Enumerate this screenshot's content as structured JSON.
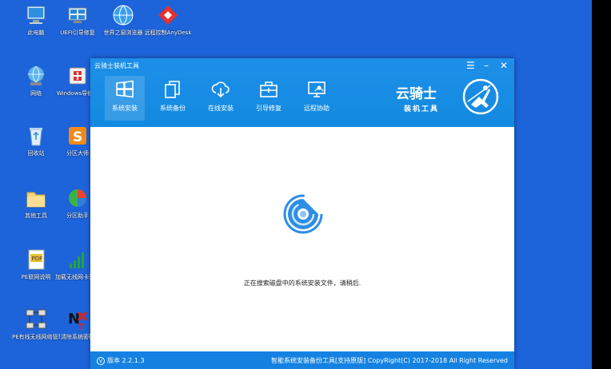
{
  "desktop": {
    "icons": [
      {
        "label": "此电脑",
        "icon": "computer-icon"
      },
      {
        "label": "UEFI引导修复",
        "icon": "uefi-repair-icon"
      },
      {
        "label": "世界之窗浏览器",
        "icon": "browser-globe-icon"
      },
      {
        "label": "远程控制AnyDesk",
        "icon": "anydesk-icon"
      },
      {
        "label": "网络",
        "icon": "network-icon"
      },
      {
        "label": "Windows导修复",
        "icon": "windows-repair-icon"
      },
      {
        "label": "回收站",
        "icon": "recycle-bin-icon"
      },
      {
        "label": "分区大师",
        "icon": "partition-master-icon"
      },
      {
        "label": "其他工具",
        "icon": "folder-icon"
      },
      {
        "label": "分区助手",
        "icon": "partition-assistant-icon"
      },
      {
        "label": "PE联网说明",
        "icon": "pdf-document-icon"
      },
      {
        "label": "加载无线网卡驱动",
        "icon": "wifi-signal-icon"
      },
      {
        "label": "PE有线无线网络管理",
        "icon": "network-manager-icon"
      },
      {
        "label": "清除系统密码",
        "icon": "clear-password-icon"
      }
    ]
  },
  "window": {
    "title": "云骑士装机工具",
    "controls": {
      "menu": "☰",
      "minimize": "–",
      "close": "✕"
    },
    "toolbar": [
      {
        "label": "系统安装",
        "icon": "windows-logo-icon",
        "active": true
      },
      {
        "label": "系统备份",
        "icon": "copy-backup-icon",
        "active": false
      },
      {
        "label": "在线安装",
        "icon": "cloud-download-icon",
        "active": false
      },
      {
        "label": "引导修复",
        "icon": "toolbox-icon",
        "active": false
      },
      {
        "label": "远程协助",
        "icon": "remote-screen-icon",
        "active": false
      }
    ],
    "brand": {
      "name": "云骑士",
      "subtitle": "装机工具"
    },
    "status": "正在搜索磁盘中的系统安装文件，请稍后.",
    "footer": {
      "version": "版本 2.2.1.3",
      "version_icon": "V",
      "copyright": "智能系统安装备份工具[支持原版]  CopyRight(C) 2017-2018 All Right Reserved"
    }
  },
  "colors": {
    "desktop": "#1d63da",
    "titlebar": "#1589e2",
    "footer": "#1582e2",
    "spinner": "#2e8ee6"
  }
}
